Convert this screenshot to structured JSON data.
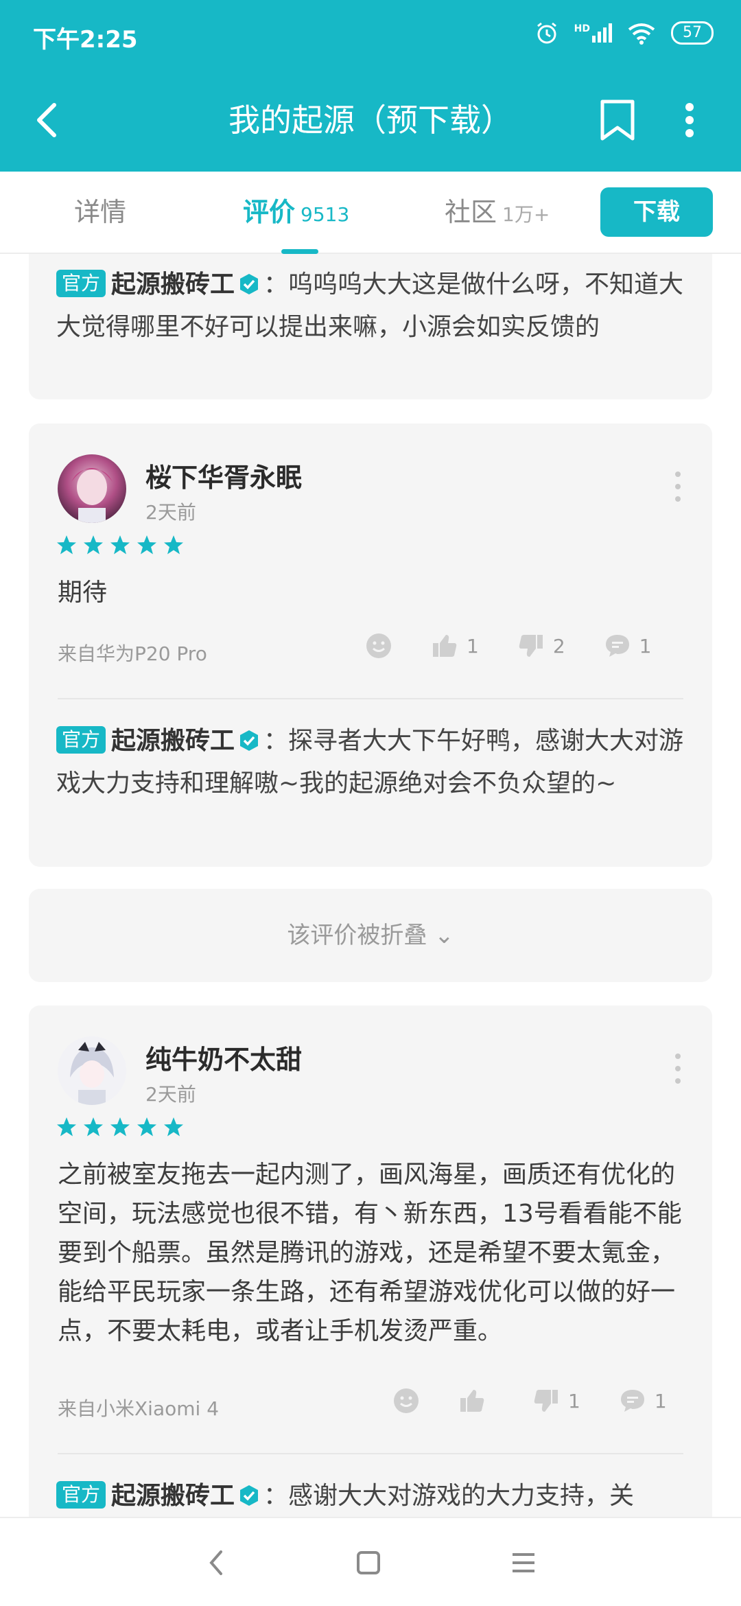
{
  "status_bar": {
    "time": "下午2:25",
    "signal_label": "HD",
    "battery": "57"
  },
  "header": {
    "title": "我的起源（预下载）"
  },
  "tabs": [
    {
      "label": "详情",
      "count": ""
    },
    {
      "label": "评价",
      "count": "9513"
    },
    {
      "label": "社区",
      "count": "1万+"
    }
  ],
  "download_label": "下载",
  "official_tag": "官方",
  "official_name": "起源搬砖工",
  "reply_top": "：呜呜呜大大这是做什么呀，不知道大大觉得哪里不好可以提出来嘛，小源会如实反馈的",
  "reviews": [
    {
      "username": "桜下华胥永眠",
      "time": "2天前",
      "rating": 5,
      "text": "期待",
      "device": "来自华为P20 Pro",
      "likes": "1",
      "dislikes": "2",
      "comments": "1",
      "reply": "：探寻者大大下午好鸭，感谢大大对游戏大力支持和理解嗷~我的起源绝对会不负众望的~"
    },
    {
      "username": "纯牛奶不太甜",
      "time": "2天前",
      "rating": 5,
      "text": "之前被室友拖去一起内测了，画风海星，画质还有优化的空间，玩法感觉也很不错，有丶新东西，13号看看能不能要到个船票。虽然是腾讯的游戏，还是希望不要太氪金，能给平民玩家一条生路，还有希望游戏优化可以做的好一点，不要太耗电，或者让手机发烫严重。",
      "device": "来自小米Xiaomi 4",
      "likes": "",
      "dislikes": "1",
      "comments": "1",
      "reply": "：感谢大大对游戏的大力支持，关"
    }
  ],
  "folded_text": "该评价被折叠 ⌄",
  "colors": {
    "accent": "#17b8c6",
    "card_bg": "#f5f5f5",
    "muted": "#9a9a9a"
  }
}
